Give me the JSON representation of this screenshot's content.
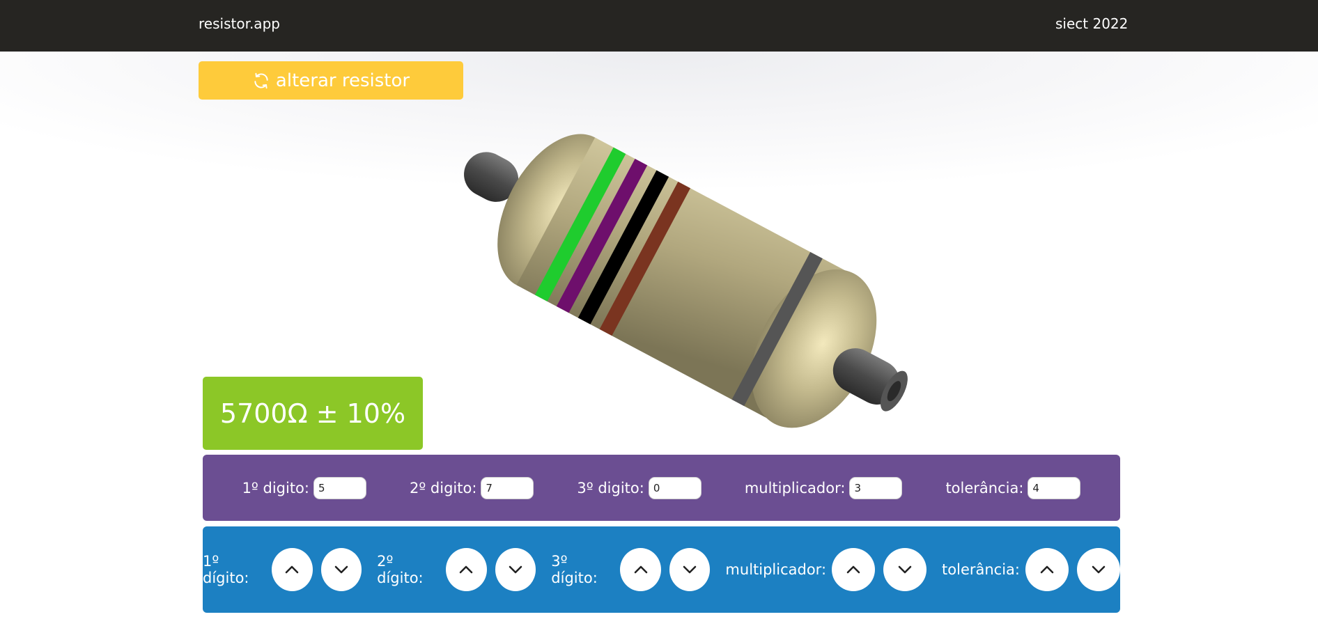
{
  "navbar": {
    "brand": "resistor.app",
    "right_text": "siect 2022"
  },
  "change_button": {
    "label": "alterar resistor",
    "icon": "refresh-icon"
  },
  "resistor": {
    "bands": [
      {
        "name": "1º dígito",
        "color": "#1fcc2e"
      },
      {
        "name": "2º dígito",
        "color": "#6e0f6c"
      },
      {
        "name": "3º dígito",
        "color": "#000000"
      },
      {
        "name": "multiplicador",
        "color": "#7a3420"
      },
      {
        "name": "tolerância",
        "color": "#555555"
      }
    ],
    "body_color": "#b6ac85"
  },
  "result": {
    "text": "5700Ω ± 10%"
  },
  "inputs": [
    {
      "label": "1º digito:",
      "value": "5"
    },
    {
      "label": "2º digito:",
      "value": "7"
    },
    {
      "label": "3º digito:",
      "value": "0"
    },
    {
      "label": "multiplicador:",
      "value": "3"
    },
    {
      "label": "tolerância:",
      "value": "4"
    }
  ],
  "steppers": [
    {
      "label": "1º dígito:",
      "up_icon": "chevron-up-icon",
      "down_icon": "chevron-down-icon"
    },
    {
      "label": "2º dígito:",
      "up_icon": "chevron-up-icon",
      "down_icon": "chevron-down-icon"
    },
    {
      "label": "3º dígito:",
      "up_icon": "chevron-up-icon",
      "down_icon": "chevron-down-icon"
    },
    {
      "label": "multiplicador:",
      "up_icon": "chevron-up-icon",
      "down_icon": "chevron-down-icon"
    },
    {
      "label": "tolerância:",
      "up_icon": "chevron-up-icon",
      "down_icon": "chevron-down-icon"
    }
  ],
  "colors": {
    "navbar": "#262522",
    "change_button": "#fecb3b",
    "result": "#8cc727",
    "inputs_panel": "#6b4e92",
    "buttons_panel": "#1c80c2"
  }
}
